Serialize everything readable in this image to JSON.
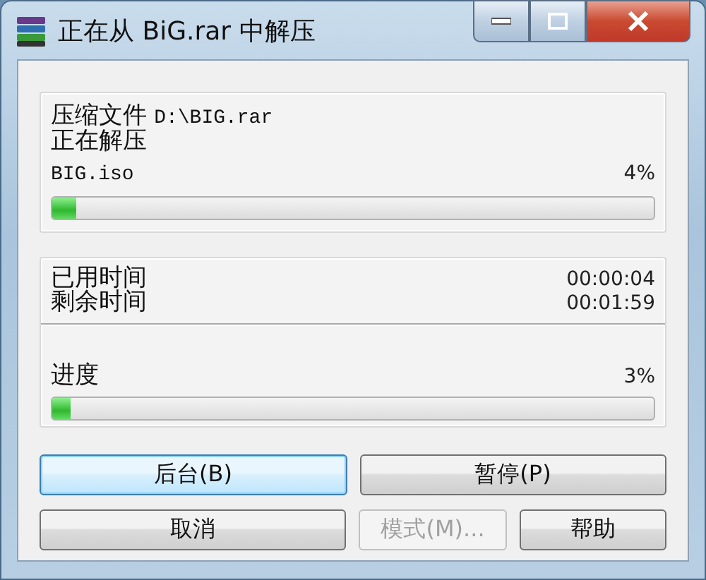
{
  "window": {
    "title": "正在从 BiG.rar 中解压"
  },
  "archive_panel": {
    "archive_label": "压缩文件",
    "archive_path": "D:\\BIG.rar",
    "status": "正在解压",
    "file_name": "BIG.iso",
    "file_percent": "4%",
    "file_progress": {
      "level": 0.04
    }
  },
  "time_panel": {
    "times": [
      {
        "label": "已用时间",
        "value": "00:00:04"
      },
      {
        "label": "剩余时间",
        "value": "00:01:59"
      }
    ],
    "progress_label": "进度",
    "progress_percent": "3%",
    "total_progress": {
      "level": 0.03
    }
  },
  "button_rows": [
    [
      {
        "label": "后台(B)",
        "focused": true,
        "disabled": false
      },
      {
        "label": "暂停(P)",
        "focused": false,
        "disabled": false
      }
    ],
    [
      {
        "label": "取消",
        "focused": false,
        "disabled": false
      },
      {
        "label": "模式(M)...",
        "focused": false,
        "disabled": true
      },
      {
        "label": "帮助",
        "focused": false,
        "disabled": false
      }
    ]
  ]
}
